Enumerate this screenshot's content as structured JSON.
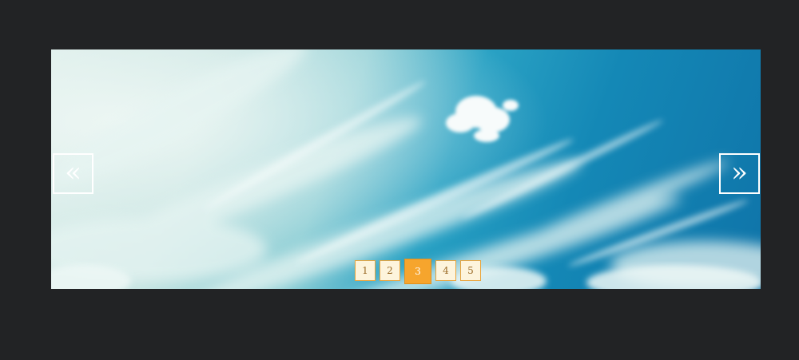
{
  "slider": {
    "prev_label": "«",
    "next_label": "»",
    "pages": [
      "1",
      "2",
      "3",
      "4",
      "5"
    ],
    "active_page": "3",
    "colors": {
      "background": "#222325",
      "active_page": "#f6a52d",
      "page_border": "#e8a33a",
      "page_fill": "#fdf4dc"
    },
    "slide_icon": "sky-clouds-image"
  }
}
